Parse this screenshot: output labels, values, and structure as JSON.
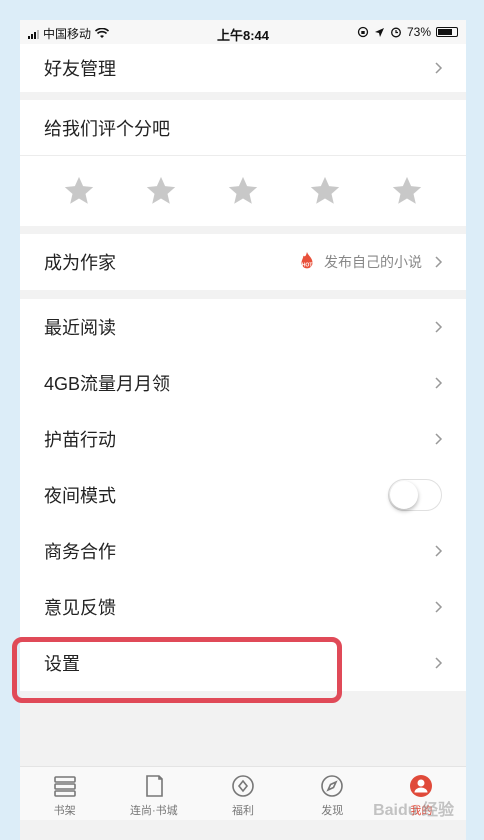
{
  "status_bar": {
    "carrier": "中国移动",
    "time": "上午8:44",
    "battery": "73%"
  },
  "menu": {
    "friends": "好友管理",
    "rate_title": "给我们评个分吧",
    "rating_stars": 5,
    "become_writer": "成为作家",
    "hot_badge": "HOT",
    "publish_novel": "发布自己的小说",
    "recent_reading": "最近阅读",
    "data_4gb": "4GB流量月月领",
    "seedling_action": "护苗行动",
    "night_mode": "夜间模式",
    "business": "商务合作",
    "feedback": "意见反馈",
    "settings": "设置"
  },
  "tabs": [
    {
      "label": "书架",
      "icon": "bookshelf-icon"
    },
    {
      "label": "连尚·书城",
      "icon": "bookstore-icon"
    },
    {
      "label": "福利",
      "icon": "welfare-icon"
    },
    {
      "label": "发现",
      "icon": "compass-icon"
    },
    {
      "label": "我的",
      "icon": "profile-icon"
    }
  ],
  "watermark": "Baidu 经验",
  "colors": {
    "accent": "#e04a3a",
    "highlight_border": "#e04a58",
    "star": "#c8c8c8"
  }
}
